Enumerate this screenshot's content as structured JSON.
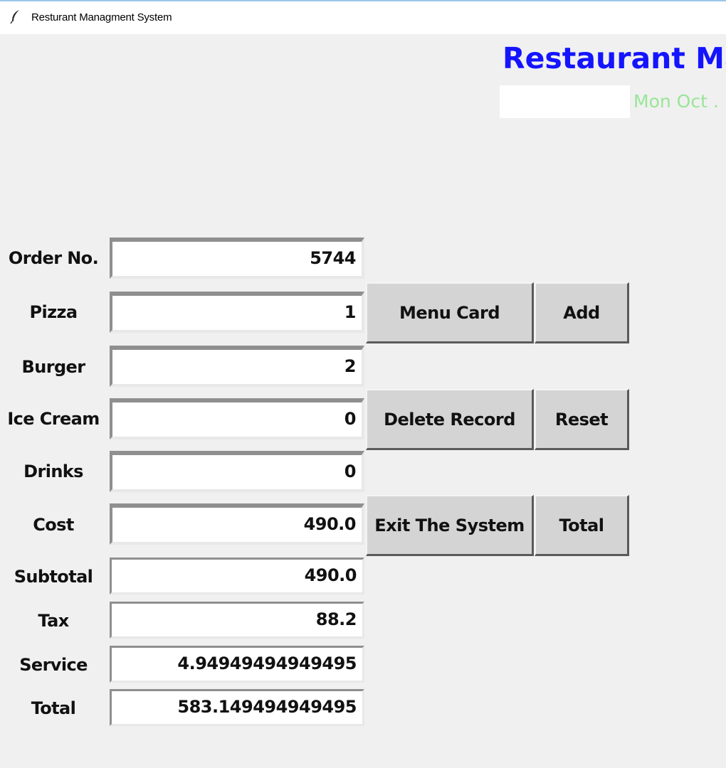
{
  "window": {
    "title": "Resturant Managment System"
  },
  "header": {
    "title": "Restaurant Ma",
    "date": "Mon Oct ."
  },
  "form": {
    "fields": [
      {
        "label": "Order No.",
        "value": "5744"
      },
      {
        "label": "Pizza",
        "value": "1"
      },
      {
        "label": "Burger",
        "value": "2"
      },
      {
        "label": "Ice Cream",
        "value": "0"
      },
      {
        "label": "Drinks",
        "value": "0"
      },
      {
        "label": "Cost",
        "value": "490.0"
      },
      {
        "label": "Subtotal",
        "value": "490.0"
      },
      {
        "label": "Tax",
        "value": "88.2"
      },
      {
        "label": "Service",
        "value": "4.94949494949495"
      },
      {
        "label": "Total",
        "value": "583.149494949495"
      }
    ]
  },
  "buttons": {
    "menu_card": "Menu Card",
    "add": "Add",
    "delete_record": "Delete Record",
    "reset": "Reset",
    "exit": "Exit The System",
    "total": "Total"
  },
  "colors": {
    "title": "#1414ff",
    "date": "#98e598",
    "background": "#f0f0f0",
    "button": "#d4d4d4"
  },
  "icons": {
    "titlebar": "feather-icon"
  }
}
